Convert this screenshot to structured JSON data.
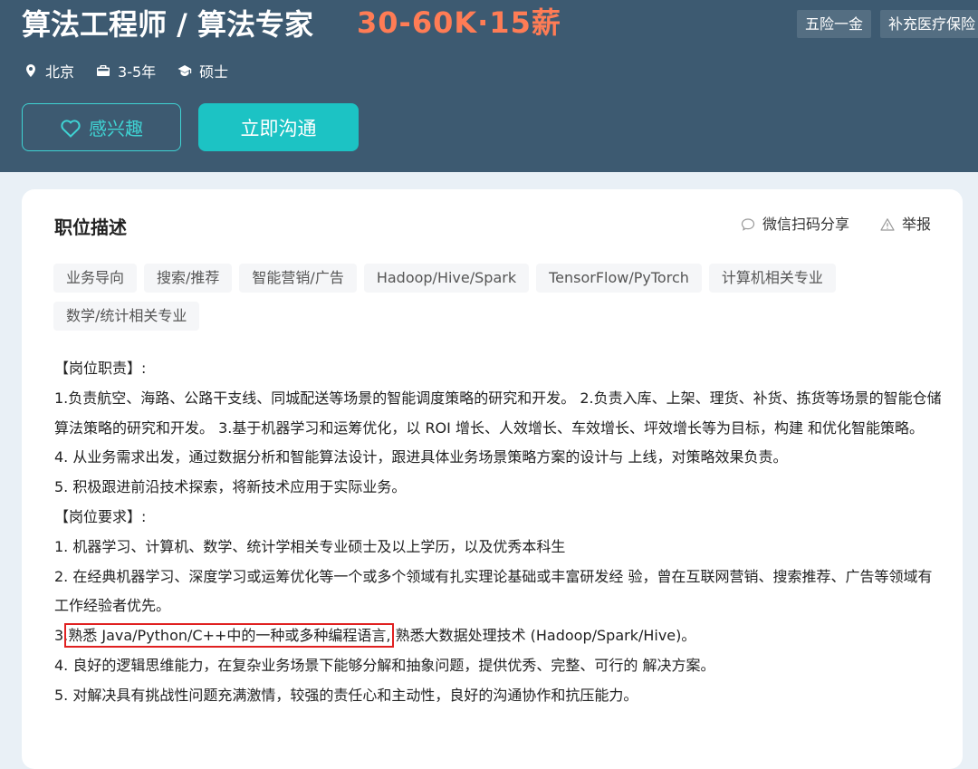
{
  "header": {
    "title": "算法工程师 / 算法专家",
    "salary": "30-60K·15薪",
    "benefits": [
      "五险一金",
      "补充医疗保险"
    ],
    "meta": {
      "location": "北京",
      "experience": "3-5年",
      "degree": "硕士"
    },
    "interest_label": "感兴趣",
    "chat_label": "立即沟通"
  },
  "card": {
    "title": "职位描述",
    "share_label": "微信扫码分享",
    "report_label": "举报",
    "tags": [
      "业务导向",
      "搜索/推荐",
      "智能营销/广告",
      "Hadoop/Hive/Spark",
      "TensorFlow/PyTorch",
      "计算机相关专业",
      "数学/统计相关专业"
    ],
    "lines": {
      "l0": "【岗位职责】:",
      "l1": "1.负责航空、海路、公路干支线、同城配送等场景的智能调度策略的研究和开发。 2.负责入库、上架、理货、补货、拣货等场景的智能仓储算法策略的研究和开发。 3.基于机器学习和运筹优化，以 ROI 增长、人效增长、车效增长、坪效增长等为目标，构建 和优化智能策略。",
      "l2": "4. 从业务需求出发，通过数据分析和智能算法设计，跟进具体业务场景策略方案的设计与 上线，对策略效果负责。",
      "l3": "5. 积极跟进前沿技术探索，将新技术应用于实际业务。",
      "l4": "【岗位要求】:",
      "l5": "1. 机器学习、计算机、数学、统计学相关专业硕士及以上学历，以及优秀本科生",
      "l6": "2. 在经典机器学习、深度学习或运筹优化等一个或多个领域有扎实理论基础或丰富研发经 验，曾在互联网营销、搜索推荐、广告等领域有工作经验者优先。",
      "l7_prefix": "3.",
      "l7_highlight": "熟悉 Java/Python/C++中的一种或多种编程语言,",
      "l7_suffix": "熟悉大数据处理技术 (Hadoop/Spark/Hive)。",
      "l8": "4. 良好的逻辑思维能力，在复杂业务场景下能够分解和抽象问题，提供优秀、完整、可行的 解决方案。",
      "l9": "5. 对解决具有挑战性问题充满激情，较强的责任心和主动性，良好的沟通协作和抗压能力。"
    }
  },
  "colors": {
    "header_bg": "#3d5a71",
    "salary": "#ff7c55",
    "accent": "#1cc3c4",
    "highlight_box": "#e02020"
  }
}
